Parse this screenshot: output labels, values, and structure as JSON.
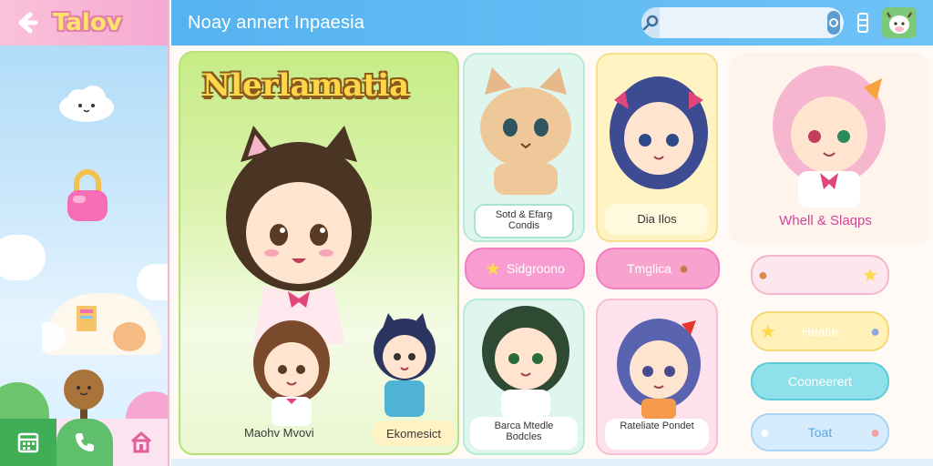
{
  "app": {
    "logo": "Talov",
    "title": "Noay annert Inpaesia"
  },
  "search": {
    "value": "",
    "placeholder": ""
  },
  "hero": {
    "title": "Nlerlamatia",
    "label_left": "Maohv Mvovi",
    "label_right": "Ekomesict"
  },
  "cards": {
    "cat": {
      "label": "Sotd & Efarg Condis"
    },
    "blue": {
      "label": "Dia Ilos"
    },
    "green": {
      "label": "Barca Mtedle Bodcles"
    },
    "pink": {
      "label": "Rateliate Pondet"
    }
  },
  "pills": {
    "stage": "Sidgroono",
    "tagline": "Tmglica"
  },
  "right_panel": {
    "title": "Whell & Slaqps",
    "buttons": [
      "",
      "Heatie",
      "Cooneerert",
      "Toat"
    ]
  },
  "colors": {
    "topbar": "#55b3f0",
    "accent_pink": "#f89dd2",
    "accent_green": "#5fbf6c",
    "accent_yellow": "#ffd84a"
  },
  "icons": {
    "back": "back-arrow-icon",
    "search": "search-icon",
    "menu": "menu-icon",
    "nav": [
      "calendar-icon",
      "phone-icon",
      "home-icon"
    ]
  }
}
